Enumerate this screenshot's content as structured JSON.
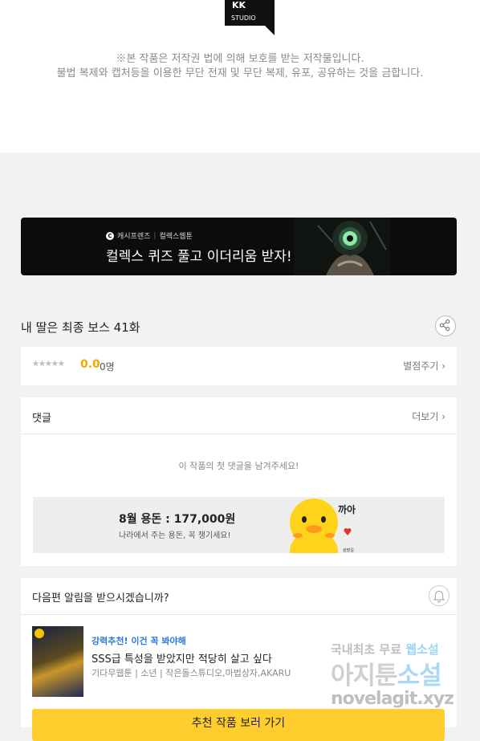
{
  "logo": {
    "text": "KK",
    "subtext": "STUDIO"
  },
  "copyright": {
    "line1": "※본 작품은 저작권 법에 의해 보호를 받는 저작물입니다.",
    "line2": "불법 복제와 캡처등을 이용한 무단 전재 및 무단 복제, 유포, 공유하는 것을 금합니다."
  },
  "banner": {
    "brand1": "캐시프렌즈",
    "separator": "|",
    "brand2": "컬렉스웹툰",
    "title": "컬렉스 퀴즈 풀고 이더리움 받자!"
  },
  "episode": {
    "title": "내 딸은 최종 보스 41화",
    "share_icon": "share-icon"
  },
  "rating": {
    "stars": "★★★★★",
    "score": "0.0",
    "count": "0명",
    "rate_link": "별점주기 ›",
    "star_color": "#bbbbbb",
    "score_color": "#f2a900"
  },
  "comments": {
    "title": "댓글",
    "more": "더보기 ›",
    "empty": "이 작품의 첫 댓글을 남겨주세요!",
    "ad": {
      "title": "8월 용돈 : 177,000원",
      "subtitle": "나라에서 주는 용돈, 꼭 챙기세요!",
      "bubble": "까아",
      "credit": "삼장길"
    }
  },
  "notify": {
    "title": "다음편 알림을 받으시겠습니까?",
    "bell_icon": "bell-icon",
    "recommend": {
      "tag": "강력추천! 이건 꼭 봐야해",
      "title": "SSS급 특성을 받았지만 적당히 살고 싶다",
      "meta": "기다무웹툰 | 소년 | 작은돌스튜디오,마법상자,AKARU",
      "button": "추천 작품 보러 가기",
      "tag_color": "#2a7bd8",
      "button_color": "#ffcd2e"
    }
  },
  "watermark": {
    "line1_a": "국내최초 무료 ",
    "line1_b": "웹소설",
    "line2_a": "아지툰",
    "line2_b": "소설",
    "line3": "novelagit.xyz"
  }
}
